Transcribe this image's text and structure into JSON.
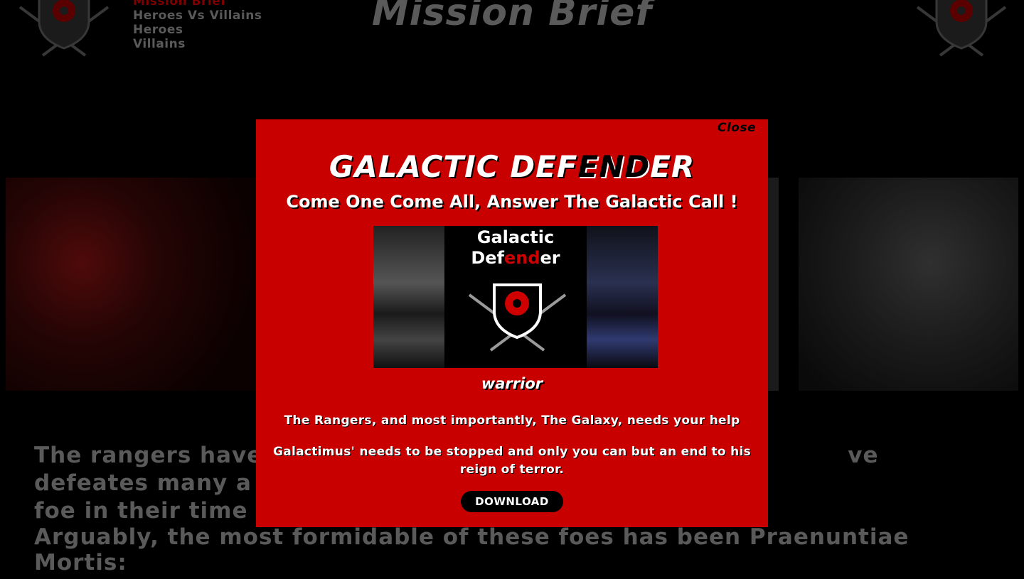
{
  "nav": {
    "items": [
      {
        "label": "Mission Brief",
        "active": true
      },
      {
        "label": "Heroes Vs Villains",
        "active": false
      },
      {
        "label": "Heroes",
        "active": false
      },
      {
        "label": "Villains",
        "active": false
      }
    ]
  },
  "page": {
    "title": "Mission Brief",
    "paragraph1": "The rangers have be [obscured] ve defeates many a foe in their time",
    "paragraph1_left": "The rangers have be",
    "paragraph1_right": "ve defeates many a",
    "paragraph1_line2": "foe in their time",
    "paragraph2": "Arguably, the most formidable of these foes has been Praenuntiae Mortis:"
  },
  "modal": {
    "close_label": "Close",
    "title_prefix": "GALACTIC DEF",
    "title_accent": "END",
    "title_suffix": "ER",
    "subtitle": "Come One Come All, Answer The Galactic Call !",
    "banner": {
      "line1": "Galactic",
      "line2_prefix": "Def",
      "line2_accent": "end",
      "line2_suffix": "er"
    },
    "role": "warrior",
    "paragraph1": "The Rangers, and most importantly, The Galaxy, needs your help",
    "paragraph2": "Galactimus' needs to be stopped and only you can but an end to his reign of terror.",
    "download_label": "DOWNLOAD"
  },
  "colors": {
    "modal_bg": "#c80000",
    "accent_red": "#d00000",
    "page_bg": "#000000",
    "dim_text": "#8a8a8a"
  },
  "icons": [
    "shield-emblem-icon",
    "crossed-swords-icon"
  ]
}
